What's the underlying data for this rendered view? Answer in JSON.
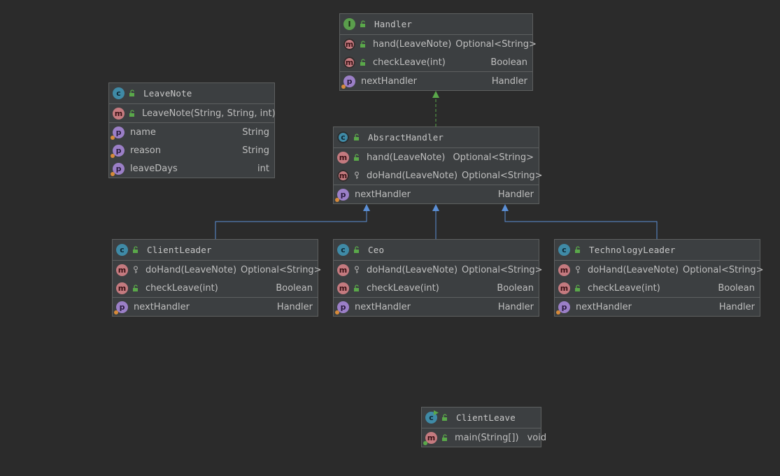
{
  "colors": {
    "background": "#2b2b2b",
    "node_fill": "#3c3f41",
    "node_border": "#5e6060",
    "implements_arrow": "#5aa84a",
    "extends_arrow": "#5b8fd6",
    "interface_badge": "#5a9e4c",
    "class_badge": "#3f8aa6",
    "method_badge": "#c47a7f",
    "property_badge": "#9b7fc7"
  },
  "nodes": [
    {
      "id": "handler",
      "title": "Handler",
      "kind_icon": "interface-icon",
      "kind_letter": "I",
      "methods": [
        {
          "name": "hand(LeaveNote)",
          "type": "Optional<String>",
          "visibility": "public",
          "abstract": true
        },
        {
          "name": "checkLeave(int)",
          "type": "Boolean",
          "visibility": "public",
          "abstract": true
        }
      ],
      "fields": [
        {
          "name": "nextHandler",
          "type": "Handler"
        }
      ]
    },
    {
      "id": "leavenote",
      "title": "LeaveNote",
      "kind_icon": "class-icon",
      "kind_letter": "c",
      "methods": [
        {
          "name": "LeaveNote(String, String, int)",
          "type": "",
          "visibility": "public"
        }
      ],
      "fields": [
        {
          "name": "name",
          "type": "String"
        },
        {
          "name": "reason",
          "type": "String"
        },
        {
          "name": "leaveDays",
          "type": "int"
        }
      ]
    },
    {
      "id": "absracthandler",
      "title": "AbsractHandler",
      "kind_icon": "abstract-class-icon",
      "kind_letter": "c",
      "methods": [
        {
          "name": "hand(LeaveNote)",
          "type": "Optional<String>",
          "visibility": "public"
        },
        {
          "name": "doHand(LeaveNote)",
          "type": "Optional<String>",
          "visibility": "protected",
          "abstract": true
        }
      ],
      "fields": [
        {
          "name": "nextHandler",
          "type": "Handler"
        }
      ]
    },
    {
      "id": "clientleader",
      "title": "ClientLeader",
      "kind_icon": "class-icon",
      "kind_letter": "c",
      "methods": [
        {
          "name": "doHand(LeaveNote)",
          "type": "Optional<String>",
          "visibility": "protected"
        },
        {
          "name": "checkLeave(int)",
          "type": "Boolean",
          "visibility": "public"
        }
      ],
      "fields": [
        {
          "name": "nextHandler",
          "type": "Handler"
        }
      ]
    },
    {
      "id": "ceo",
      "title": "Ceo",
      "kind_icon": "class-icon",
      "kind_letter": "c",
      "methods": [
        {
          "name": "doHand(LeaveNote)",
          "type": "Optional<String>",
          "visibility": "protected"
        },
        {
          "name": "checkLeave(int)",
          "type": "Boolean",
          "visibility": "public"
        }
      ],
      "fields": [
        {
          "name": "nextHandler",
          "type": "Handler"
        }
      ]
    },
    {
      "id": "technologyleader",
      "title": "TechnologyLeader",
      "kind_icon": "class-icon",
      "kind_letter": "c",
      "methods": [
        {
          "name": "doHand(LeaveNote)",
          "type": "Optional<String>",
          "visibility": "protected"
        },
        {
          "name": "checkLeave(int)",
          "type": "Boolean",
          "visibility": "public"
        }
      ],
      "fields": [
        {
          "name": "nextHandler",
          "type": "Handler"
        }
      ]
    },
    {
      "id": "clientleave",
      "title": "ClientLeave",
      "kind_icon": "runnable-class-icon",
      "kind_letter": "c",
      "methods": [
        {
          "name": "main(String[])",
          "type": "void",
          "visibility": "public",
          "static": true
        }
      ],
      "fields": []
    }
  ],
  "edges": [
    {
      "from": "absracthandler",
      "to": "handler",
      "kind": "implements"
    },
    {
      "from": "clientleader",
      "to": "absracthandler",
      "kind": "extends"
    },
    {
      "from": "ceo",
      "to": "absracthandler",
      "kind": "extends"
    },
    {
      "from": "technologyleader",
      "to": "absracthandler",
      "kind": "extends"
    }
  ]
}
